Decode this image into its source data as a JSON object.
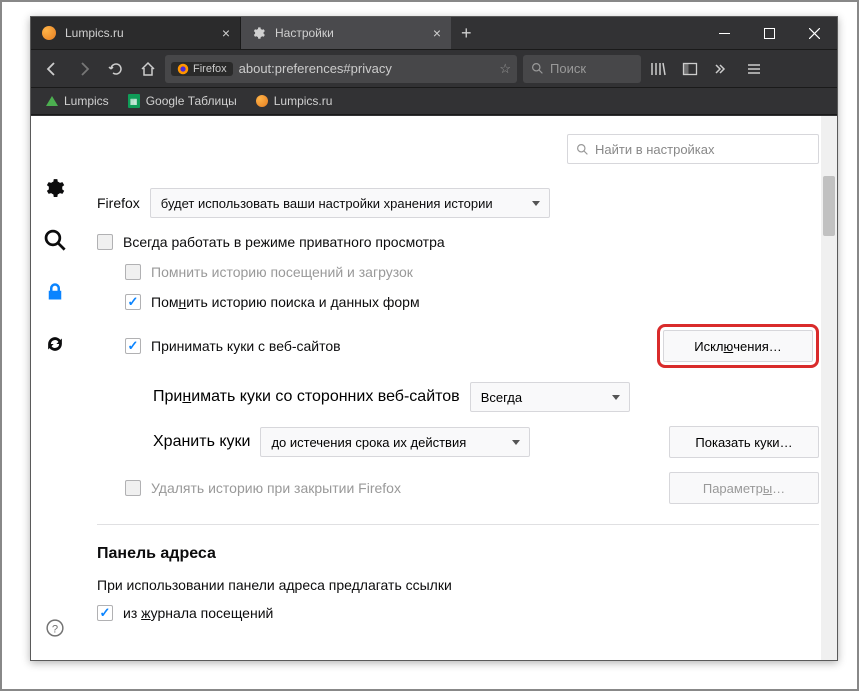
{
  "tabs": [
    {
      "label": "Lumpics.ru"
    },
    {
      "label": "Настройки"
    }
  ],
  "url": {
    "badge": "Firefox",
    "text": "about:preferences#privacy"
  },
  "searchbar": {
    "placeholder": "Поиск"
  },
  "bookmarks": [
    {
      "label": "Lumpics"
    },
    {
      "label": "Google Таблицы"
    },
    {
      "label": "Lumpics.ru"
    }
  ],
  "settings_search": {
    "placeholder": "Найти в настройках"
  },
  "history": {
    "label": "Firefox",
    "select": "будет использовать ваши настройки хранения истории",
    "always_private": "Всегда работать в режиме приватного просмотра",
    "remember_history": "Помнить историю посещений и загрузок",
    "remember_search_pre": "Пом",
    "remember_search_u": "н",
    "remember_search_post": "ить историю поиска и данных форм",
    "accept_cookies": "Принимать куки с веб-сайтов",
    "exceptions_pre": "Искл",
    "exceptions_u": "ю",
    "exceptions_post": "чения…",
    "third_party_pre": "При",
    "third_party_u": "н",
    "third_party_post": "имать куки со сторонних веб-сайтов",
    "third_party_select": "Всегда",
    "keep_cookies": "Хранить куки",
    "keep_select": "до истечения срока их действия",
    "show_cookies": "Показать куки…",
    "clear_on_close": "Удалять историю при закрытии Firefox",
    "params_pre": "Параметр",
    "params_u": "ы",
    "params_post": "…"
  },
  "addressbar": {
    "heading": "Панель адреса",
    "desc": "При использовании панели адреса предлагать ссылки",
    "history_pre": "из ",
    "history_u": "ж",
    "history_post": "урнала посещений"
  }
}
